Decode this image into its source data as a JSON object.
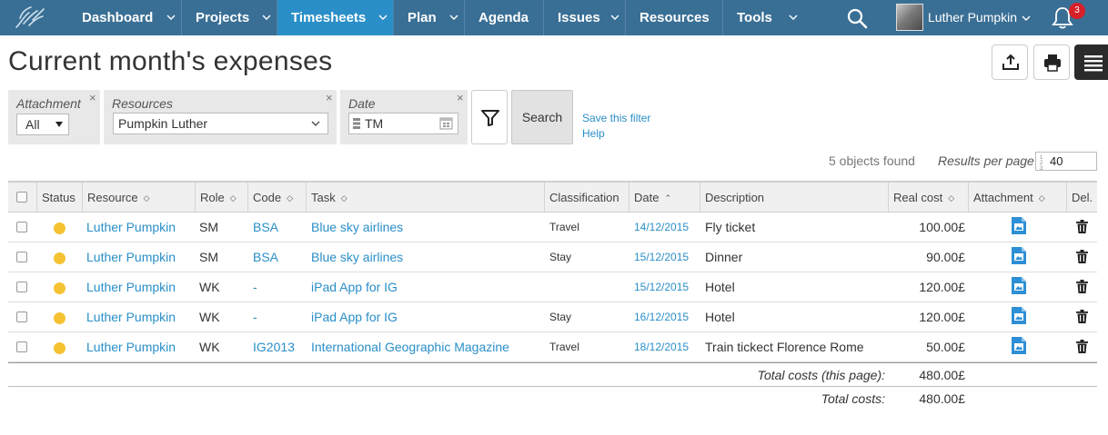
{
  "nav": {
    "items": [
      {
        "label": "Dashboard"
      },
      {
        "label": "Projects"
      },
      {
        "label": "Timesheets"
      },
      {
        "label": "Plan"
      },
      {
        "label": "Agenda"
      },
      {
        "label": "Issues"
      },
      {
        "label": "Resources"
      },
      {
        "label": "Tools"
      }
    ],
    "user_name": "Luther Pumpkin",
    "notification_count": "3",
    "colors": {
      "bar": "#3a6f95",
      "active": "#2a8fc8"
    }
  },
  "page": {
    "title": "Current month's expenses"
  },
  "filters": {
    "attachment": {
      "label": "Attachment",
      "value": "All"
    },
    "resources": {
      "label": "Resources",
      "value": "Pumpkin Luther"
    },
    "date": {
      "label": "Date",
      "value": "TM"
    },
    "search_label": "Search",
    "save_filter_label": "Save this filter",
    "help_label": "Help",
    "close_glyph": "×"
  },
  "results": {
    "found_text": "5 objects found",
    "per_page_label": "Results per page",
    "per_page_value": "40"
  },
  "table": {
    "headers": {
      "status": "Status",
      "resource": "Resource",
      "role": "Role",
      "code": "Code",
      "task": "Task",
      "classification": "Classification",
      "date": "Date",
      "description": "Description",
      "real_cost": "Real cost",
      "attachment": "Attachment",
      "del": "Del."
    },
    "sort_glyphs": {
      "both": "◇",
      "asc": "⌃"
    },
    "rows": [
      {
        "resource": "Luther Pumpkin",
        "role": "SM",
        "code": "BSA",
        "task": "Blue sky airlines",
        "classification": "Travel",
        "date": "14/12/2015",
        "description": "Fly ticket",
        "cost": "100.00£"
      },
      {
        "resource": "Luther Pumpkin",
        "role": "SM",
        "code": "BSA",
        "task": "Blue sky airlines",
        "classification": "Stay",
        "date": "15/12/2015",
        "description": "Dinner",
        "cost": "90.00£"
      },
      {
        "resource": "Luther Pumpkin",
        "role": "WK",
        "code": "-",
        "task": "iPad App for IG",
        "classification": "",
        "date": "15/12/2015",
        "description": "Hotel",
        "cost": "120.00£"
      },
      {
        "resource": "Luther Pumpkin",
        "role": "WK",
        "code": "-",
        "task": "iPad App for IG",
        "classification": "Stay",
        "date": "16/12/2015",
        "description": "Hotel",
        "cost": "120.00£"
      },
      {
        "resource": "Luther Pumpkin",
        "role": "WK",
        "code": "IG2013",
        "task": "International Geographic Magazine",
        "classification": "Travel",
        "date": "18/12/2015",
        "description": "Train tickect Florence Rome",
        "cost": "50.00£"
      }
    ],
    "status_color": "#f5c232",
    "totals": {
      "page_label": "Total costs (this page):",
      "page_value": "480.00£",
      "all_label": "Total costs:",
      "all_value": "480.00£"
    }
  }
}
